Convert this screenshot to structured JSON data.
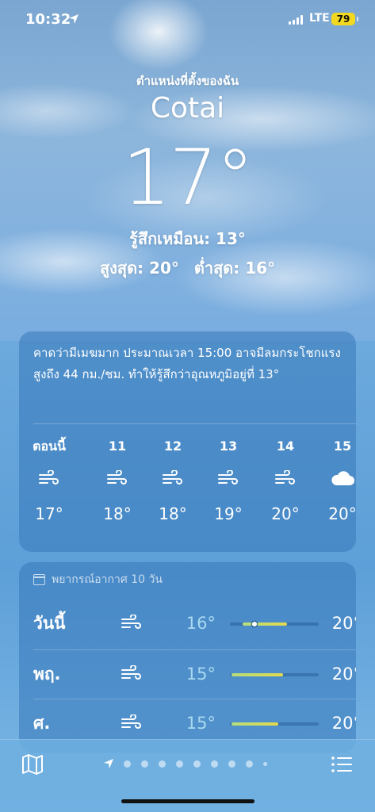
{
  "status_bar": {
    "time": "10:32",
    "network": "LTE",
    "battery": "79"
  },
  "header": {
    "location_label": "ตำแหน่งที่ตั้งของฉัน",
    "city": "Cotai",
    "temperature": "17°",
    "feels_like": "รู้สึกเหมือน: 13°",
    "high": "สูงสุด: 20°",
    "low": "ต่ำสุด: 16°"
  },
  "hourly": {
    "summary": "คาดว่ามีเมฆมาก ประมาณเวลา 15:00 อาจมีลมกระโชกแรงสูงถึง 44 กม./ชม. ทำให้รู้สึกว่าอุณหภูมิอยู่ที่ 13°",
    "items": [
      {
        "label": "ตอนนี้",
        "icon": "wind-icon",
        "temp": "17°"
      },
      {
        "label": "11",
        "icon": "wind-icon",
        "temp": "18°"
      },
      {
        "label": "12",
        "icon": "wind-icon",
        "temp": "18°"
      },
      {
        "label": "13",
        "icon": "wind-icon",
        "temp": "19°"
      },
      {
        "label": "14",
        "icon": "wind-icon",
        "temp": "20°"
      },
      {
        "label": "15",
        "icon": "cloud-icon",
        "temp": "20°"
      }
    ]
  },
  "daily": {
    "header": "พยากรณ์อากาศ 10 วัน",
    "days": [
      {
        "name": "วันนี้",
        "icon": "wind-icon",
        "low": "16°",
        "high": "20°",
        "range_start": 0.14,
        "range_end": 0.64,
        "current": 0.28
      },
      {
        "name": "พฤ.",
        "icon": "wind-icon",
        "low": "15°",
        "high": "20°",
        "range_start": 0.02,
        "range_end": 0.6
      },
      {
        "name": "ศ.",
        "icon": "wind-icon",
        "low": "15°",
        "high": "20°",
        "range_start": 0.02,
        "range_end": 0.55
      }
    ]
  },
  "bottom_bar": {
    "page_count": 9,
    "current_page": 0
  },
  "colors": {
    "battery": "#f2d81e",
    "low_temp": "#a9d9ef"
  }
}
